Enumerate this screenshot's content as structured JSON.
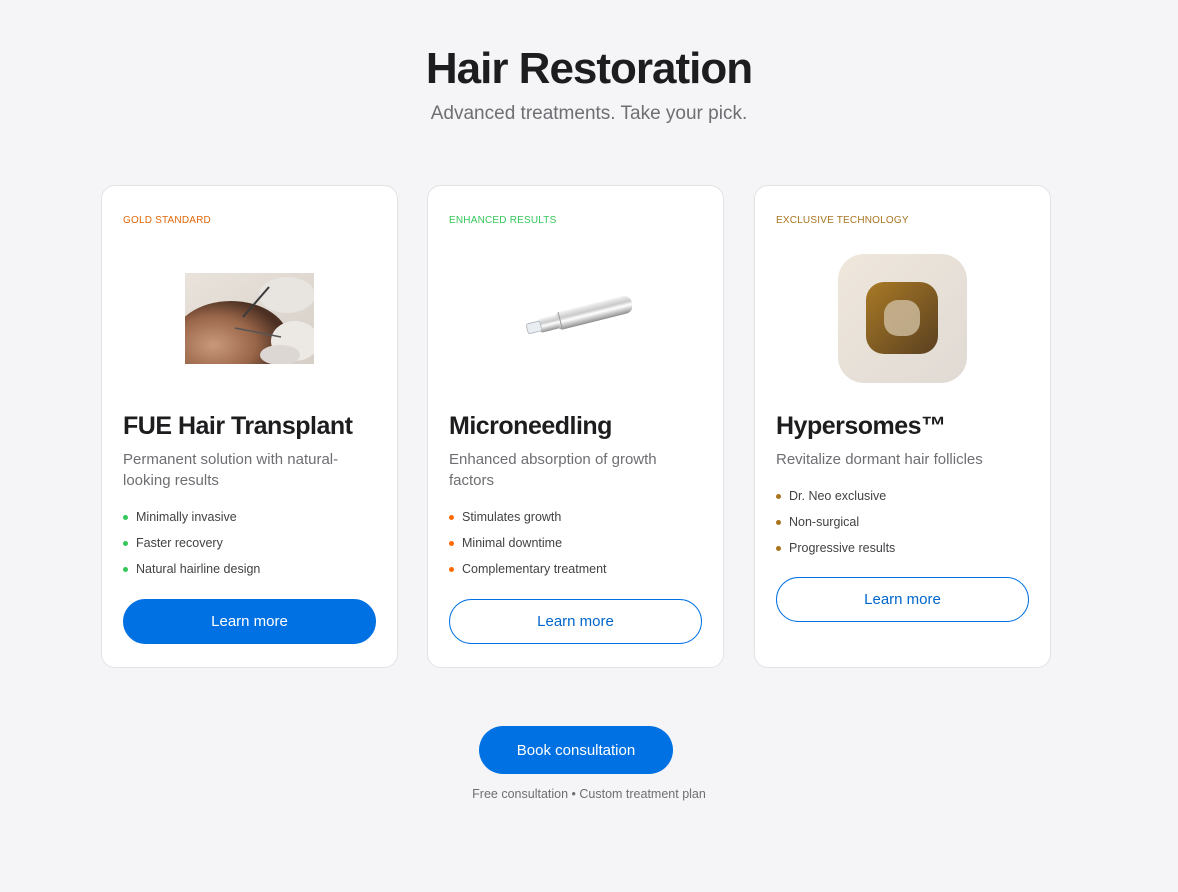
{
  "header": {
    "title": "Hair Restoration",
    "subtitle": "Advanced treatments. Take your pick."
  },
  "cards": [
    {
      "badge": "Gold Standard",
      "badge_color": "#e0660a",
      "title": "FUE Hair Transplant",
      "description": "Permanent solution with natural-looking results",
      "bullet_color": "#34c759",
      "features": [
        "Minimally invasive",
        "Faster recovery",
        "Natural hairline design"
      ],
      "cta_label": "Learn more",
      "cta_style": "filled",
      "image": "fue-procedure-photo"
    },
    {
      "badge": "Enhanced Results",
      "badge_color": "#34c759",
      "title": "Microneedling",
      "description": "Enhanced absorption of growth factors",
      "bullet_color": "#ff6a00",
      "features": [
        "Stimulates growth",
        "Minimal downtime",
        "Complementary treatment"
      ],
      "cta_label": "Learn more",
      "cta_style": "outline",
      "image": "microneedling-pen-photo"
    },
    {
      "badge": "Exclusive Technology",
      "badge_color": "#a8741e",
      "title": "Hypersomes™",
      "description": "Revitalize dormant hair follicles",
      "bullet_color": "#a8741e",
      "features": [
        "Dr. Neo exclusive",
        "Non-surgical",
        "Progressive results"
      ],
      "cta_label": "Learn more",
      "cta_style": "outline",
      "image": "hypersomes-app-icon"
    }
  ],
  "footer": {
    "book_label": "Book consultation",
    "note": "Free consultation • Custom treatment plan"
  },
  "colors": {
    "accent": "#0071e3",
    "background": "#f5f5f7"
  }
}
